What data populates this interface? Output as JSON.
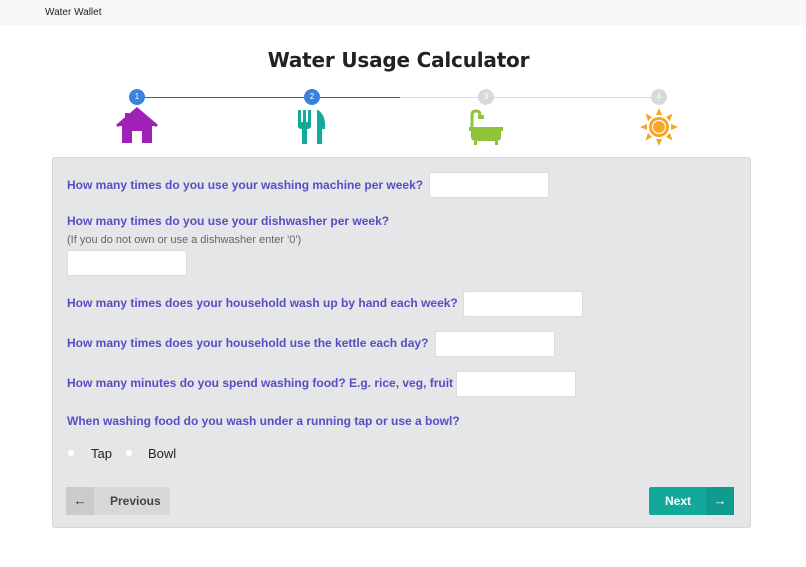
{
  "app": {
    "brand": "Water Wallet"
  },
  "page": {
    "title": "Water Usage Calculator"
  },
  "stepper": {
    "steps": [
      {
        "number": "1",
        "icon": "home-icon",
        "color": "#a020b8",
        "state": "complete"
      },
      {
        "number": "2",
        "icon": "fork-knife-icon",
        "color": "#12a99a",
        "state": "current"
      },
      {
        "number": "3",
        "icon": "bathtub-icon",
        "color": "#8fc43a",
        "state": "upcoming"
      },
      {
        "number": "4",
        "icon": "sun-icon",
        "color": "#f5a623",
        "state": "upcoming"
      }
    ]
  },
  "form": {
    "q_washing_machine": "How many times do you use your washing machine per week?",
    "q_dishwasher": "How many times do you use your dishwasher per week?",
    "q_dishwasher_hint": "(If you do not own or use a dishwasher enter '0')",
    "q_hand_wash": "How many times does your household wash up by hand each week?",
    "q_kettle": "How many times does your household use the kettle each day?",
    "q_washing_food": "How many minutes do you spend washing food? E.g. rice, veg, fruit",
    "q_tap_or_bowl": "When washing food do you wash under a running tap or use a bowl?",
    "washing_machine_value": "",
    "dishwasher_value": "",
    "hand_wash_value": "",
    "kettle_value": "",
    "washing_food_value": "",
    "option_tap": "Tap",
    "option_bowl": "Bowl"
  },
  "nav": {
    "previous_label": "Previous",
    "next_label": "Next"
  },
  "colors": {
    "question": "#5a4cc4",
    "step_active": "#3b82e0",
    "next_button": "#12a99a"
  }
}
